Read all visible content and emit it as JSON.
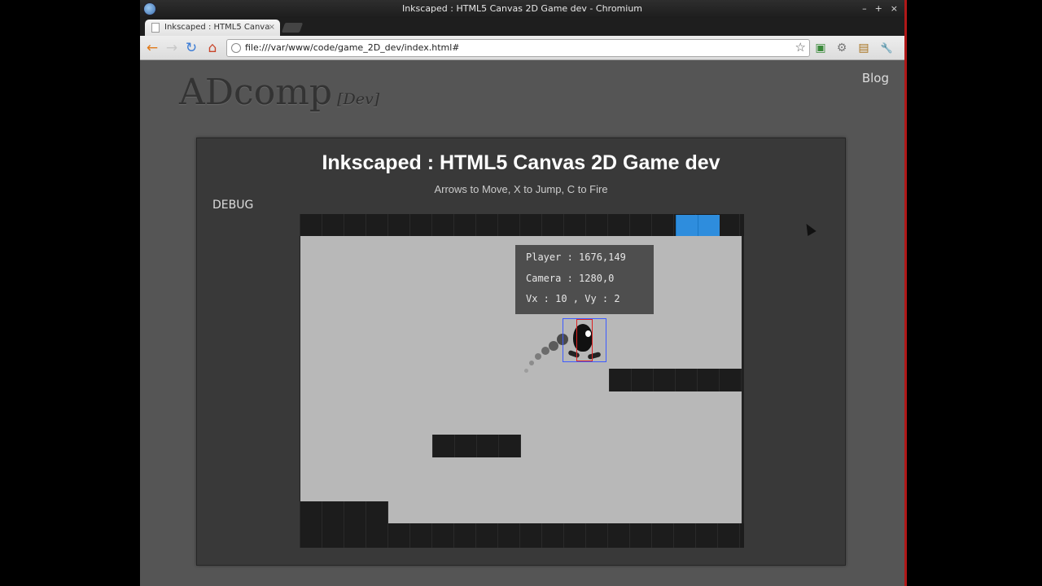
{
  "window": {
    "title": "Inkscaped : HTML5 Canvas 2D Game dev - Chromium",
    "controls": [
      "–",
      "+",
      "×"
    ]
  },
  "tabs": [
    {
      "label": "Inkscaped : HTML5 Canva",
      "close": "×"
    }
  ],
  "toolbar": {
    "back": "←",
    "forward": "→",
    "reload": "↻",
    "home": "⌂",
    "url": "file:///var/www/code/game_2D_dev/index.html#",
    "star": "☆",
    "ext1": "▣",
    "ext2": "⚙",
    "ext3": "▤",
    "wrench": "🔧"
  },
  "site": {
    "brand": "ADcomp",
    "brand_tag": "[Dev]",
    "blog": "Blog"
  },
  "game": {
    "title": "Inkscaped : HTML5 Canvas 2D Game dev",
    "help": "Arrows to Move, X to Jump, C to Fire",
    "debug_label": "DEBUG",
    "debug_lines": {
      "player": "Player : 1676,149",
      "camera": "Camera : 1280,0",
      "velocity": "Vx : 10 , Vy : 2"
    }
  },
  "colors": {
    "water": "#2e8ddd",
    "tile": "#1c1c1c",
    "sky": "#b8b8b8",
    "hitbox_outer": "#3d5bff",
    "hitbox_inner": "#dd2222"
  }
}
